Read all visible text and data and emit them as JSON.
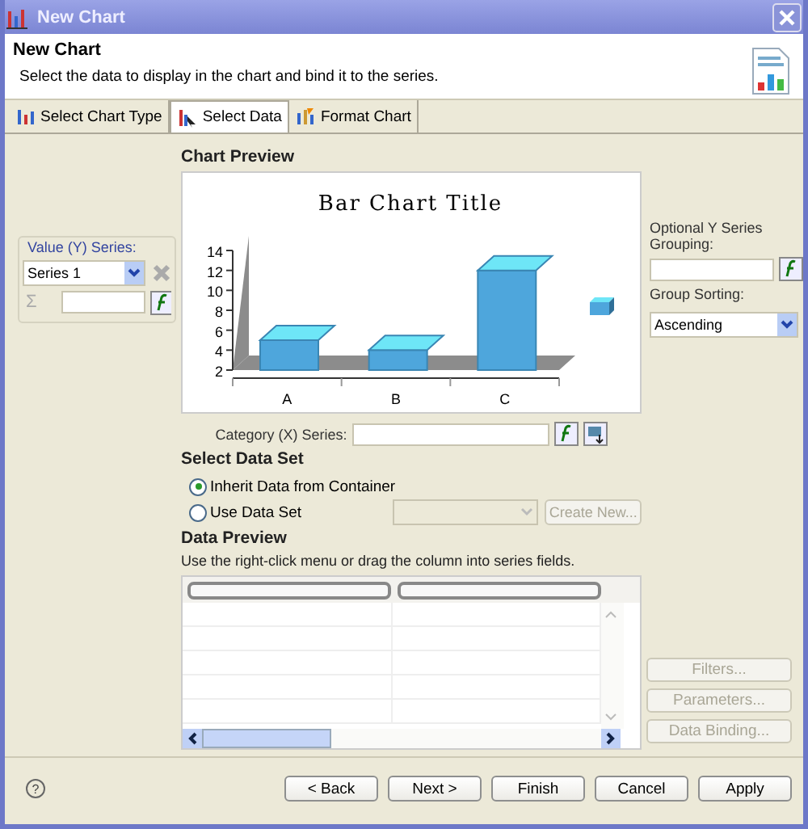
{
  "window": {
    "title": "New Chart"
  },
  "header": {
    "title": "New Chart",
    "description": "Select the data to display in the chart and bind it to the series."
  },
  "tabs": [
    {
      "label": "Select Chart Type",
      "selected": false
    },
    {
      "label": "Select Data",
      "selected": true
    },
    {
      "label": "Format Chart",
      "selected": false
    }
  ],
  "value_series": {
    "label": "Value (Y) Series:",
    "series": "Series 1",
    "sum_symbol": "Σ"
  },
  "chart_preview": {
    "label": "Chart Preview",
    "chart_data": {
      "type": "bar",
      "title": "Bar Chart Title",
      "categories": [
        "A",
        "B",
        "C"
      ],
      "series": [
        {
          "color": "#4ea6dc",
          "values": [
            5,
            4,
            12
          ]
        }
      ],
      "ylim": [
        2,
        14
      ],
      "yticks": [
        2,
        4,
        6,
        8,
        10,
        12,
        14
      ]
    }
  },
  "grouping": {
    "label": "Optional Y Series Grouping:",
    "sorting_label": "Group Sorting:",
    "sorting": "Ascending"
  },
  "category_series": {
    "label": "Category (X) Series:"
  },
  "data_set": {
    "title": "Select Data Set",
    "options": [
      {
        "label": "Inherit Data from Container",
        "selected": true
      },
      {
        "label": "Use Data Set",
        "selected": false
      }
    ],
    "create_button": {
      "label": "Create New...",
      "disabled": true
    }
  },
  "data_preview": {
    "title": "Data Preview",
    "hint": "Use the right-click menu or drag the column into series fields."
  },
  "side_buttons": [
    {
      "label": "Filters...",
      "disabled": true
    },
    {
      "label": "Parameters...",
      "disabled": true
    },
    {
      "label": "Data Binding...",
      "disabled": true
    }
  ],
  "footer": {
    "help_symbol": "?",
    "buttons": [
      {
        "label": "< Back"
      },
      {
        "label": "Next >"
      },
      {
        "label": "Finish"
      },
      {
        "label": "Cancel"
      },
      {
        "label": "Apply"
      }
    ]
  }
}
